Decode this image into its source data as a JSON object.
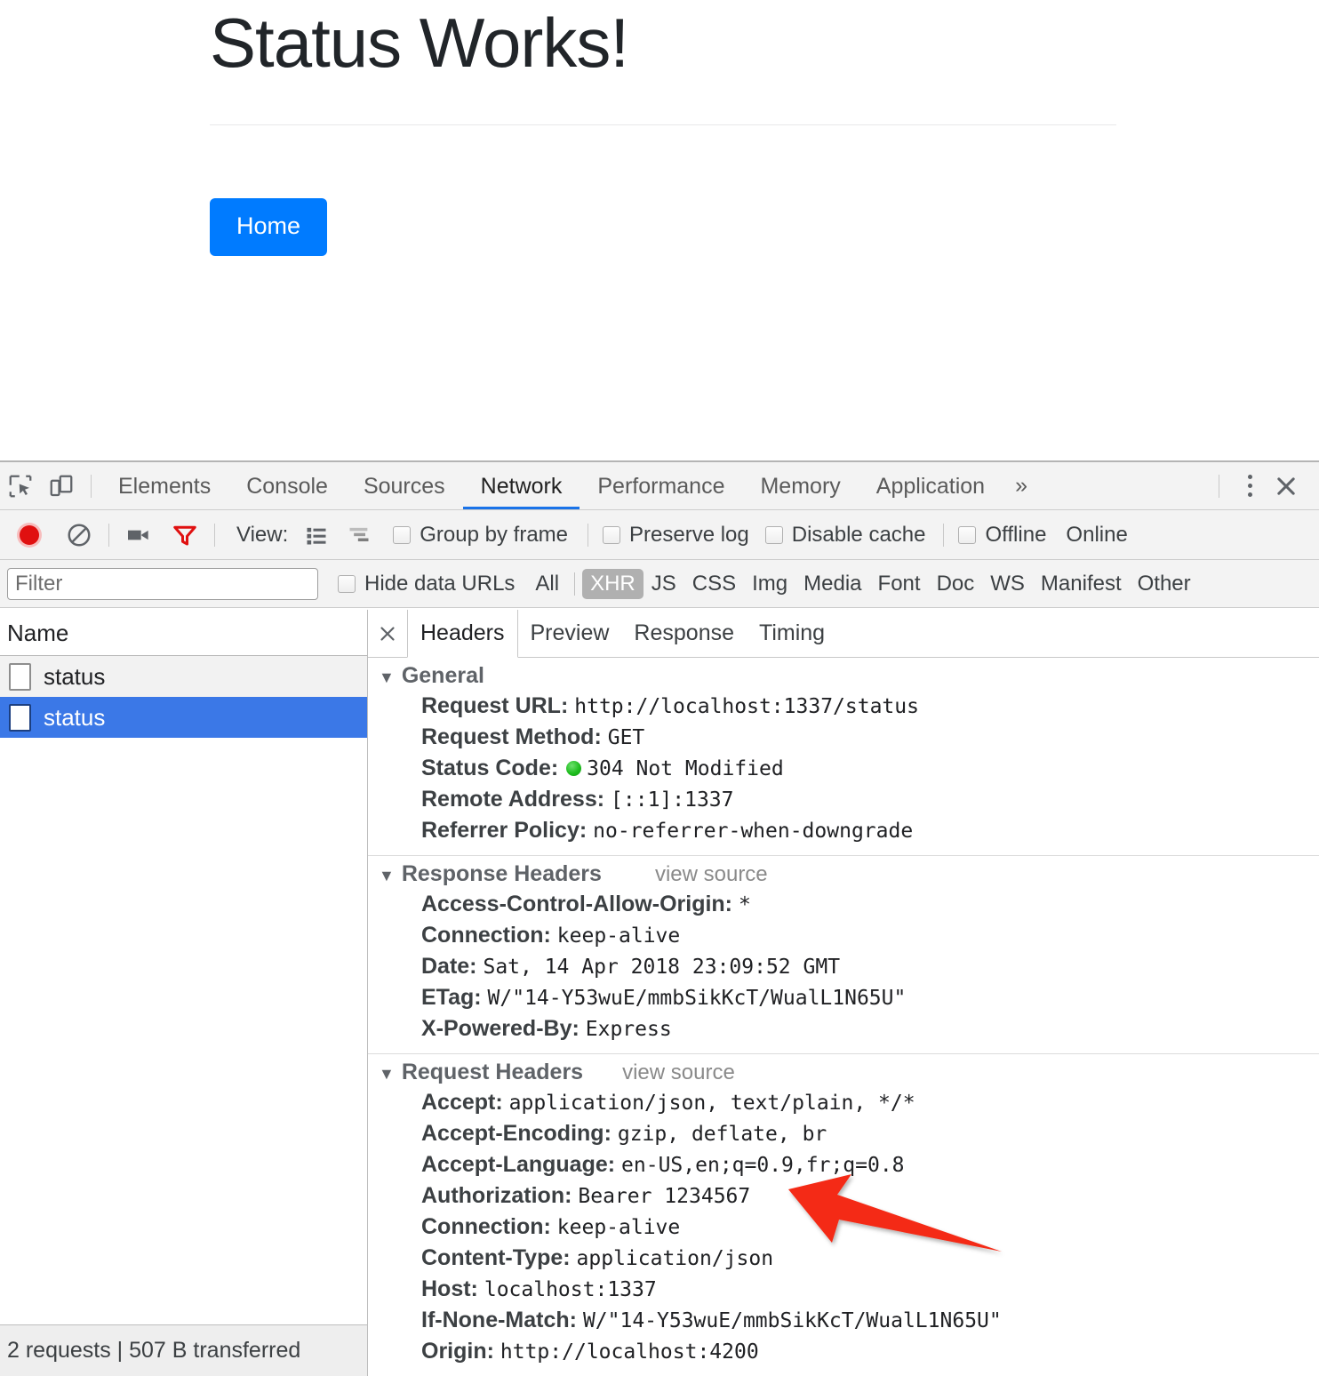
{
  "page": {
    "title": "Status Works!",
    "home_button": "Home"
  },
  "devtools": {
    "tabs": [
      {
        "label": "Elements",
        "active": false
      },
      {
        "label": "Console",
        "active": false
      },
      {
        "label": "Sources",
        "active": false
      },
      {
        "label": "Network",
        "active": true
      },
      {
        "label": "Performance",
        "active": false
      },
      {
        "label": "Memory",
        "active": false
      },
      {
        "label": "Application",
        "active": false
      }
    ],
    "more_tabs_chevron": "»",
    "inspect_icon": "inspect-element-icon",
    "device_icon": "device-toolbar-icon",
    "kebab_icon": "more-options-icon",
    "close_icon": "close-devtools-icon",
    "controls": {
      "record_icon": "record-icon",
      "clear_icon": "clear-icon",
      "screenshot_icon": "camera-icon",
      "filter_icon": "filter-funnel-icon",
      "view_label": "View:",
      "view_list_icon": "list-view-icon",
      "view_waterfall_icon": "waterfall-view-icon",
      "group_by_frame": "Group by frame",
      "preserve_log": "Preserve log",
      "disable_cache": "Disable cache",
      "offline": "Offline",
      "online": "Online"
    },
    "filterbar": {
      "filter_placeholder": "Filter",
      "filter_value": "",
      "hide_data_urls": "Hide data URLs",
      "types": [
        {
          "label": "All",
          "selected": false
        },
        {
          "label": "XHR",
          "selected": true
        },
        {
          "label": "JS",
          "selected": false
        },
        {
          "label": "CSS",
          "selected": false
        },
        {
          "label": "Img",
          "selected": false
        },
        {
          "label": "Media",
          "selected": false
        },
        {
          "label": "Font",
          "selected": false
        },
        {
          "label": "Doc",
          "selected": false
        },
        {
          "label": "WS",
          "selected": false
        },
        {
          "label": "Manifest",
          "selected": false
        },
        {
          "label": "Other",
          "selected": false
        }
      ]
    },
    "requests": {
      "column_header": "Name",
      "rows": [
        {
          "name": "status",
          "selected": false
        },
        {
          "name": "status",
          "selected": true
        }
      ]
    },
    "statusbar": "2 requests | 507 B transferred",
    "detail_tabs": [
      {
        "label": "Headers",
        "active": true
      },
      {
        "label": "Preview",
        "active": false
      },
      {
        "label": "Response",
        "active": false
      },
      {
        "label": "Timing",
        "active": false
      }
    ],
    "detail_close_icon": "close-detail-icon",
    "view_source_label": "view source",
    "sections": [
      {
        "title": "General",
        "has_view_source": false,
        "rows": [
          {
            "name": "Request URL:",
            "value": "http://localhost:1337/status"
          },
          {
            "name": "Request Method:",
            "value": "GET"
          },
          {
            "name": "Status Code:",
            "value": "304 Not Modified",
            "dot": "green-status-dot"
          },
          {
            "name": "Remote Address:",
            "value": "[::1]:1337"
          },
          {
            "name": "Referrer Policy:",
            "value": "no-referrer-when-downgrade"
          }
        ]
      },
      {
        "title": "Response Headers",
        "has_view_source": true,
        "rows": [
          {
            "name": "Access-Control-Allow-Origin:",
            "value": "*"
          },
          {
            "name": "Connection:",
            "value": "keep-alive"
          },
          {
            "name": "Date:",
            "value": "Sat, 14 Apr 2018 23:09:52 GMT"
          },
          {
            "name": "ETag:",
            "value": "W/\"14-Y53wuE/mmbSikKcT/WualL1N65U\""
          },
          {
            "name": "X-Powered-By:",
            "value": "Express"
          }
        ]
      },
      {
        "title": "Request Headers",
        "has_view_source": true,
        "rows": [
          {
            "name": "Accept:",
            "value": "application/json, text/plain, */*"
          },
          {
            "name": "Accept-Encoding:",
            "value": "gzip, deflate, br"
          },
          {
            "name": "Accept-Language:",
            "value": "en-US,en;q=0.9,fr;q=0.8"
          },
          {
            "name": "Authorization:",
            "value": "Bearer 1234567"
          },
          {
            "name": "Connection:",
            "value": "keep-alive"
          },
          {
            "name": "Content-Type:",
            "value": "application/json"
          },
          {
            "name": "Host:",
            "value": "localhost:1337"
          },
          {
            "name": "If-None-Match:",
            "value": "W/\"14-Y53wuE/mmbSikKcT/WualL1N65U\""
          },
          {
            "name": "Origin:",
            "value": "http://localhost:4200"
          }
        ]
      }
    ],
    "annotation": {
      "icon": "red-arrow-annotation",
      "color": "#f42a14",
      "points_to": "Authorization: Bearer 1234567"
    }
  },
  "colors": {
    "accent_blue": "#007bff",
    "selection_blue": "#3b78e7",
    "tab_underline": "#1a73e8",
    "record_red": "#d81c1c",
    "annotation_red": "#f42a14",
    "status_green": "#1fbd1f"
  }
}
